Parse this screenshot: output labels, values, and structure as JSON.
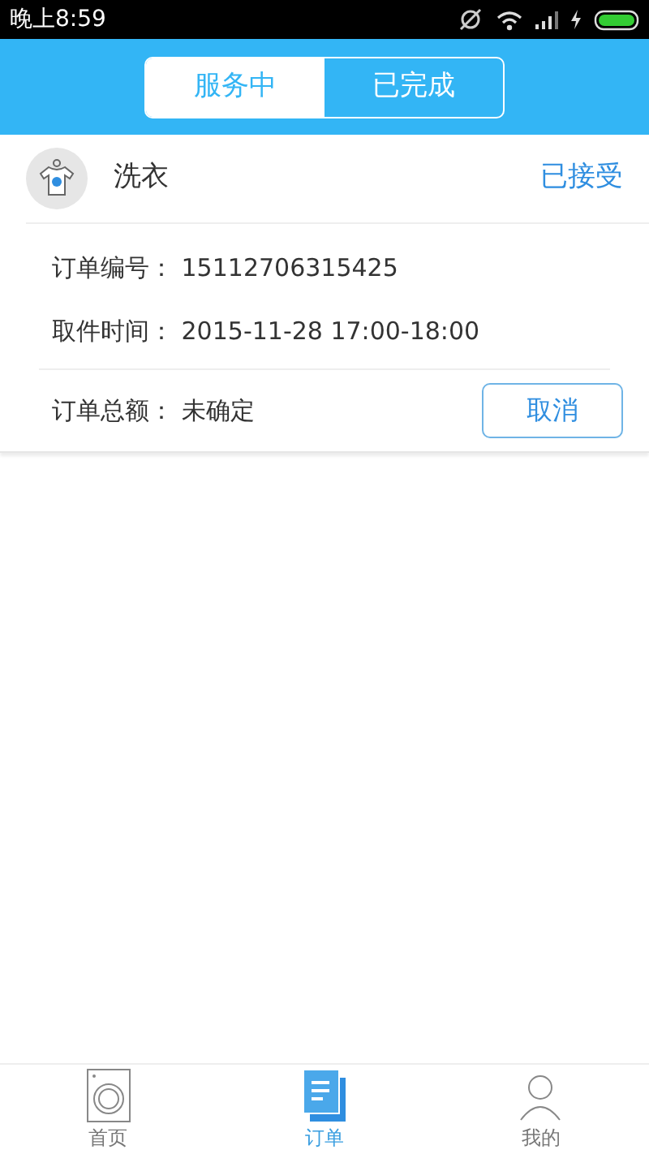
{
  "status_bar": {
    "time": "晚上8:59"
  },
  "tabs": [
    {
      "label": "服务中",
      "selected": true
    },
    {
      "label": "已完成",
      "selected": false
    }
  ],
  "orders": [
    {
      "service": "洗衣",
      "status": "已接受",
      "fields": [
        {
          "label": "订单编号：",
          "value": "15112706315425"
        },
        {
          "label": "取件时间：",
          "value": "2015-11-28 17:00-18:00"
        }
      ],
      "total": {
        "label": "订单总额：",
        "value": "未确定"
      },
      "action": "取消"
    }
  ],
  "bottom_nav": [
    {
      "label": "首页",
      "kind": "home",
      "selected": false
    },
    {
      "label": "订单",
      "kind": "orders",
      "selected": true
    },
    {
      "label": "我的",
      "kind": "profile",
      "selected": false
    }
  ]
}
